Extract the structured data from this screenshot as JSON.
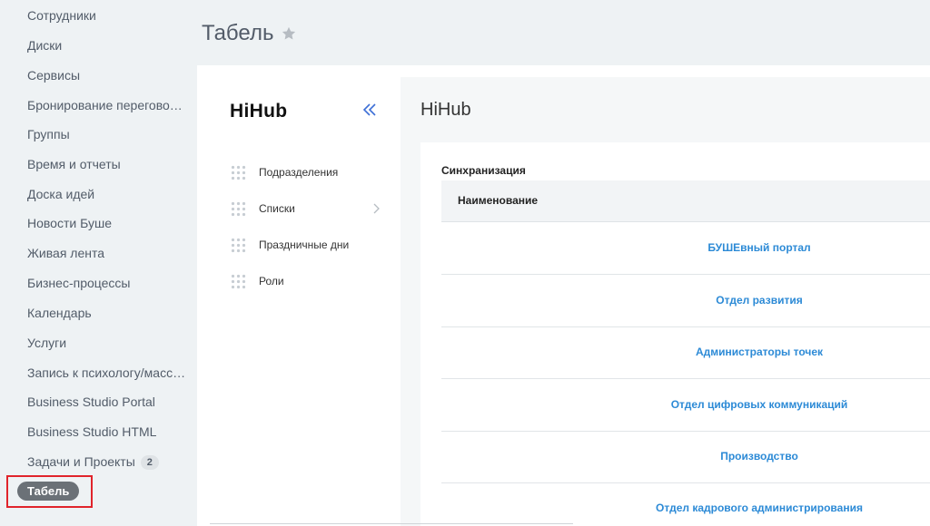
{
  "leftnav": {
    "items": [
      {
        "label": "Сотрудники"
      },
      {
        "label": "Диски"
      },
      {
        "label": "Сервисы"
      },
      {
        "label": "Бронирование переговорных"
      },
      {
        "label": "Группы"
      },
      {
        "label": "Время и отчеты"
      },
      {
        "label": "Доска идей"
      },
      {
        "label": "Новости Буше"
      },
      {
        "label": "Живая лента"
      },
      {
        "label": "Бизнес-процессы"
      },
      {
        "label": "Календарь"
      },
      {
        "label": "Услуги"
      },
      {
        "label": "Запись к психологу/массажисту"
      },
      {
        "label": "Business Studio Portal"
      },
      {
        "label": "Business Studio HTML"
      },
      {
        "label": "Задачи и Проекты",
        "counter": "2"
      }
    ],
    "active_label": "Табель"
  },
  "header": {
    "title": "Табель"
  },
  "app": {
    "logo": "HiHub",
    "side_items": [
      {
        "label": "Подразделения"
      },
      {
        "label": "Списки"
      },
      {
        "label": "Праздничные дни"
      },
      {
        "label": "Роли"
      }
    ],
    "main_title": "HiHub",
    "section_title": "Синхранизация",
    "table": {
      "column_header": "Наименование",
      "rows": [
        "БУШЕвный портал",
        "Отдел развития",
        "Администраторы точек",
        "Отдел цифровых коммуникаций",
        "Производство",
        "Отдел кадрового администрирования"
      ]
    }
  },
  "colors": {
    "link": "#2c8ad6",
    "active_pill": "#6b7177",
    "highlight_border": "#e0242b",
    "dots": "#c7cdd3",
    "collapse": "#3d6fd6"
  }
}
